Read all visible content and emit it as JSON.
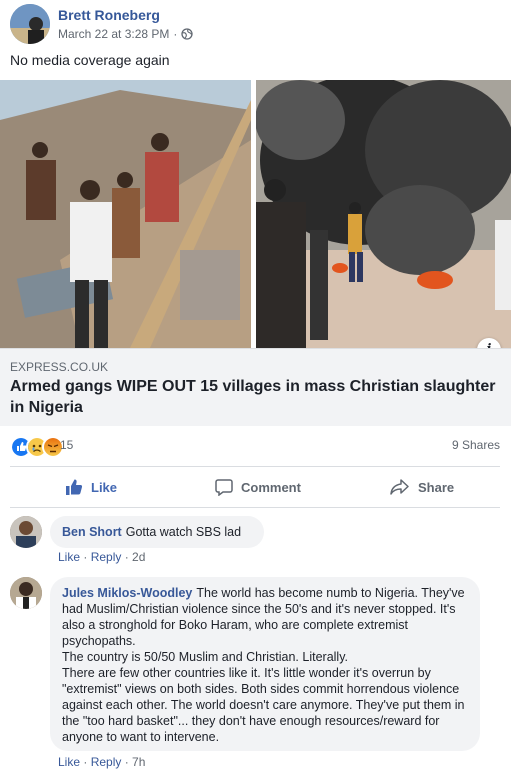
{
  "post": {
    "author": "Brett Roneberg",
    "timestamp": "March 22 at 3:28 PM",
    "privacy_icon": "globe-icon",
    "text": "No media coverage again"
  },
  "link": {
    "domain": "EXPRESS.CO.UK",
    "title": "Armed gangs WIPE OUT 15 villages in mass Christian slaughter in Nigeria"
  },
  "reactions": {
    "icons": [
      "like",
      "sad",
      "angry"
    ],
    "count": "15",
    "shares": "9 Shares"
  },
  "actions": {
    "like": "Like",
    "comment": "Comment",
    "share": "Share"
  },
  "comments": [
    {
      "name": "Ben Short",
      "text": "Gotta watch SBS lad",
      "like": "Like",
      "reply": "Reply",
      "time": "2d"
    },
    {
      "name": "Jules Miklos-Woodley",
      "text": "The world has become numb to Nigeria. They've had Muslim/Christian violence since the 50's and it's never stopped. It's also a stronghold for Boko Haram, who are complete extremist psychopaths.\nThe country is 50/50 Muslim and Christian. Literally.\nThere are few other countries like it. It's little wonder it's overrun by \"extremist\" views on both sides. Both sides commit horrendous violence against each other. The world doesn't care anymore. They've put them in the \"too hard basket\"... they don't have enough resources/reward for anyone to want to intervene.",
      "like": "Like",
      "reply": "Reply",
      "time": "7h"
    }
  ],
  "colors": {
    "link_blue": "#365899",
    "like_blue": "#4267b2",
    "secondary_text": "#606770",
    "bubble_bg": "#f2f3f5"
  }
}
